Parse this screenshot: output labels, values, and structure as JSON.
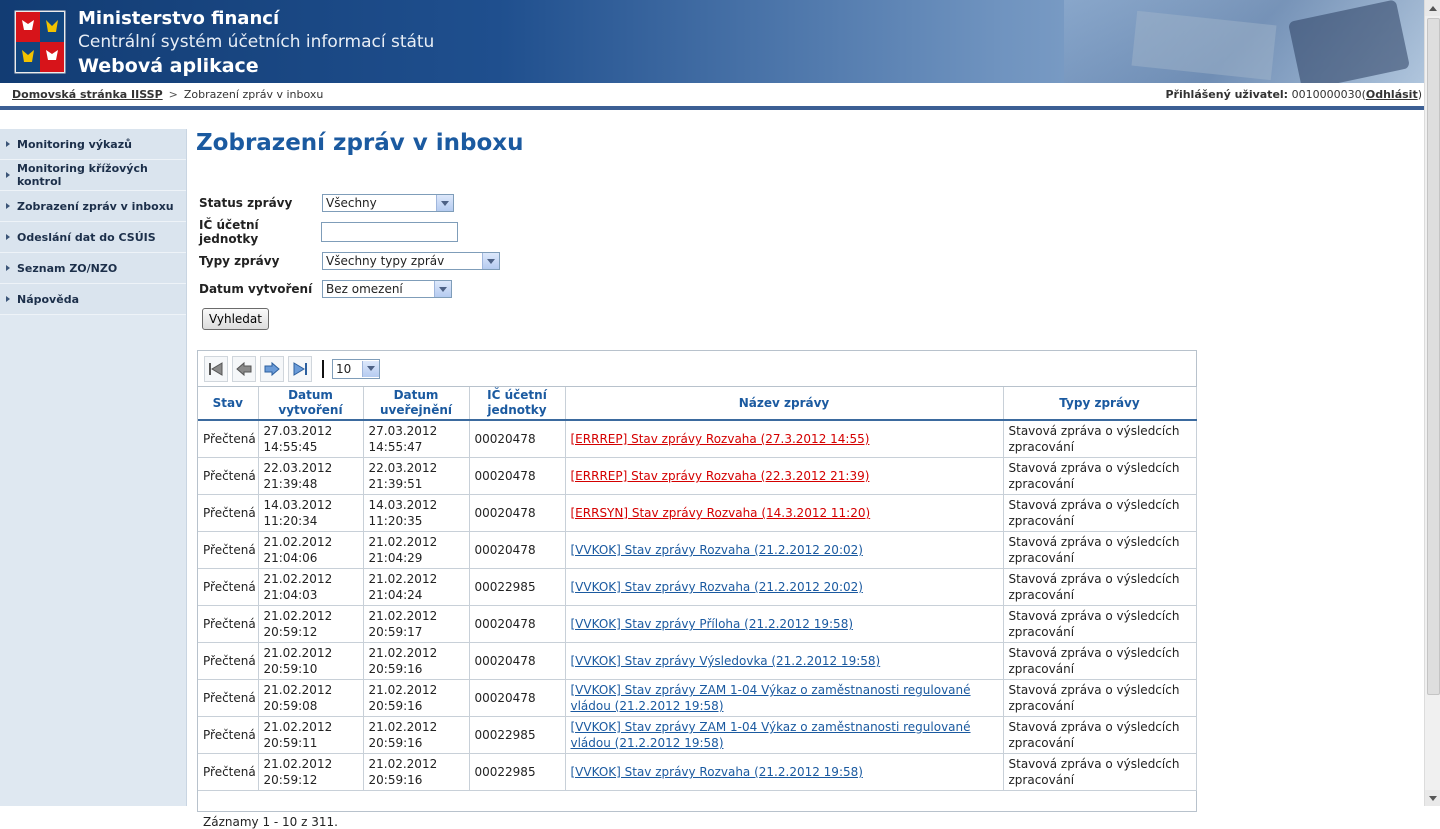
{
  "header": {
    "line1": "Ministerstvo financí",
    "line2": "Centrální systém účetních informací státu",
    "line3": "Webová aplikace"
  },
  "breadcrumb": {
    "home": "Domovská stránka IISSP",
    "separator": ">",
    "current": "Zobrazení zpráv v inboxu"
  },
  "user": {
    "label": "Přihlášený uživatel:",
    "id": "0010000030",
    "open": "(",
    "logout": "Odhlásit",
    "close": ")"
  },
  "sidebar": {
    "items": [
      {
        "label": "Monitoring výkazů"
      },
      {
        "label": "Monitoring křížových kontrol"
      },
      {
        "label": "Zobrazení zpráv v inboxu"
      },
      {
        "label": "Odeslání dat do CSÚIS"
      },
      {
        "label": "Seznam ZO/NZO"
      },
      {
        "label": "Nápověda"
      }
    ]
  },
  "page": {
    "title": "Zobrazení zpráv v inboxu"
  },
  "form": {
    "status_label": "Status zprávy",
    "status_value": "Všechny",
    "ic_label": "IČ účetní jednotky",
    "ic_value": "",
    "type_label": "Typy zprávy",
    "type_value": "Všechny typy zpráv",
    "date_label": "Datum vytvoření",
    "date_value": "Bez omezení",
    "search_button": "Vyhledat"
  },
  "pager": {
    "page_size": "10",
    "records": "Záznamy 1 - 10 z 311."
  },
  "table": {
    "headers": {
      "stav": "Stav",
      "created_1": "Datum",
      "created_2": "vytvoření",
      "published_1": "Datum",
      "published_2": "uveřejnění",
      "ic_1": "IČ účetní",
      "ic_2": "jednotky",
      "name": "Název zprávy",
      "type": "Typy zprávy"
    },
    "rows": [
      {
        "stav": "Přečtená",
        "created_d": "27.03.2012",
        "created_t": "14:55:45",
        "pub_d": "27.03.2012",
        "pub_t": "14:55:47",
        "ic": "00020478",
        "name": "[ERRREP] Stav zprávy Rozvaha (27.3.2012 14:55)",
        "status": "error",
        "type_1": "Stavová zpráva o výsledcích",
        "type_2": "zpracování"
      },
      {
        "stav": "Přečtená",
        "created_d": "22.03.2012",
        "created_t": "21:39:48",
        "pub_d": "22.03.2012",
        "pub_t": "21:39:51",
        "ic": "00020478",
        "name": "[ERRREP] Stav zprávy Rozvaha (22.3.2012 21:39)",
        "status": "error",
        "type_1": "Stavová zpráva o výsledcích",
        "type_2": "zpracování"
      },
      {
        "stav": "Přečtená",
        "created_d": "14.03.2012",
        "created_t": "11:20:34",
        "pub_d": "14.03.2012",
        "pub_t": "11:20:35",
        "ic": "00020478",
        "name": "[ERRSYN] Stav zprávy Rozvaha (14.3.2012 11:20)",
        "status": "error",
        "type_1": "Stavová zpráva o výsledcích",
        "type_2": "zpracování"
      },
      {
        "stav": "Přečtená",
        "created_d": "21.02.2012",
        "created_t": "21:04:06",
        "pub_d": "21.02.2012",
        "pub_t": "21:04:29",
        "ic": "00020478",
        "name": "[VVKOK] Stav zprávy Rozvaha (21.2.2012 20:02)",
        "status": "ok",
        "type_1": "Stavová zpráva o výsledcích",
        "type_2": "zpracování"
      },
      {
        "stav": "Přečtená",
        "created_d": "21.02.2012",
        "created_t": "21:04:03",
        "pub_d": "21.02.2012",
        "pub_t": "21:04:24",
        "ic": "00022985",
        "name": "[VVKOK] Stav zprávy Rozvaha (21.2.2012 20:02)",
        "status": "ok",
        "type_1": "Stavová zpráva o výsledcích",
        "type_2": "zpracování"
      },
      {
        "stav": "Přečtená",
        "created_d": "21.02.2012",
        "created_t": "20:59:12",
        "pub_d": "21.02.2012",
        "pub_t": "20:59:17",
        "ic": "00020478",
        "name": "[VVKOK] Stav zprávy Příloha (21.2.2012 19:58)",
        "status": "ok",
        "type_1": "Stavová zpráva o výsledcích",
        "type_2": "zpracování"
      },
      {
        "stav": "Přečtená",
        "created_d": "21.02.2012",
        "created_t": "20:59:10",
        "pub_d": "21.02.2012",
        "pub_t": "20:59:16",
        "ic": "00020478",
        "name": "[VVKOK] Stav zprávy Výsledovka (21.2.2012 19:58)",
        "status": "ok",
        "type_1": "Stavová zpráva o výsledcích",
        "type_2": "zpracování"
      },
      {
        "stav": "Přečtená",
        "created_d": "21.02.2012",
        "created_t": "20:59:08",
        "pub_d": "21.02.2012",
        "pub_t": "20:59:16",
        "ic": "00020478",
        "name": "[VVKOK] Stav zprávy ZAM 1-04 Výkaz o zaměstnanosti regulované vládou (21.2.2012 19:58)",
        "status": "ok",
        "type_1": "Stavová zpráva o výsledcích",
        "type_2": "zpracování"
      },
      {
        "stav": "Přečtená",
        "created_d": "21.02.2012",
        "created_t": "20:59:11",
        "pub_d": "21.02.2012",
        "pub_t": "20:59:16",
        "ic": "00022985",
        "name": "[VVKOK] Stav zprávy ZAM 1-04 Výkaz o zaměstnanosti regulované vládou (21.2.2012 19:58)",
        "status": "ok",
        "type_1": "Stavová zpráva o výsledcích",
        "type_2": "zpracování"
      },
      {
        "stav": "Přečtená",
        "created_d": "21.02.2012",
        "created_t": "20:59:12",
        "pub_d": "21.02.2012",
        "pub_t": "20:59:16",
        "ic": "00022985",
        "name": "[VVKOK] Stav zprávy Rozvaha (21.2.2012 19:58)",
        "status": "ok",
        "type_1": "Stavová zpráva o výsledcích",
        "type_2": "zpracování"
      }
    ]
  },
  "colors": {
    "title": "#1b5aa0",
    "link_error": "#d40000",
    "link_ok": "#1b5aa0",
    "header_dark": "#123c73"
  }
}
